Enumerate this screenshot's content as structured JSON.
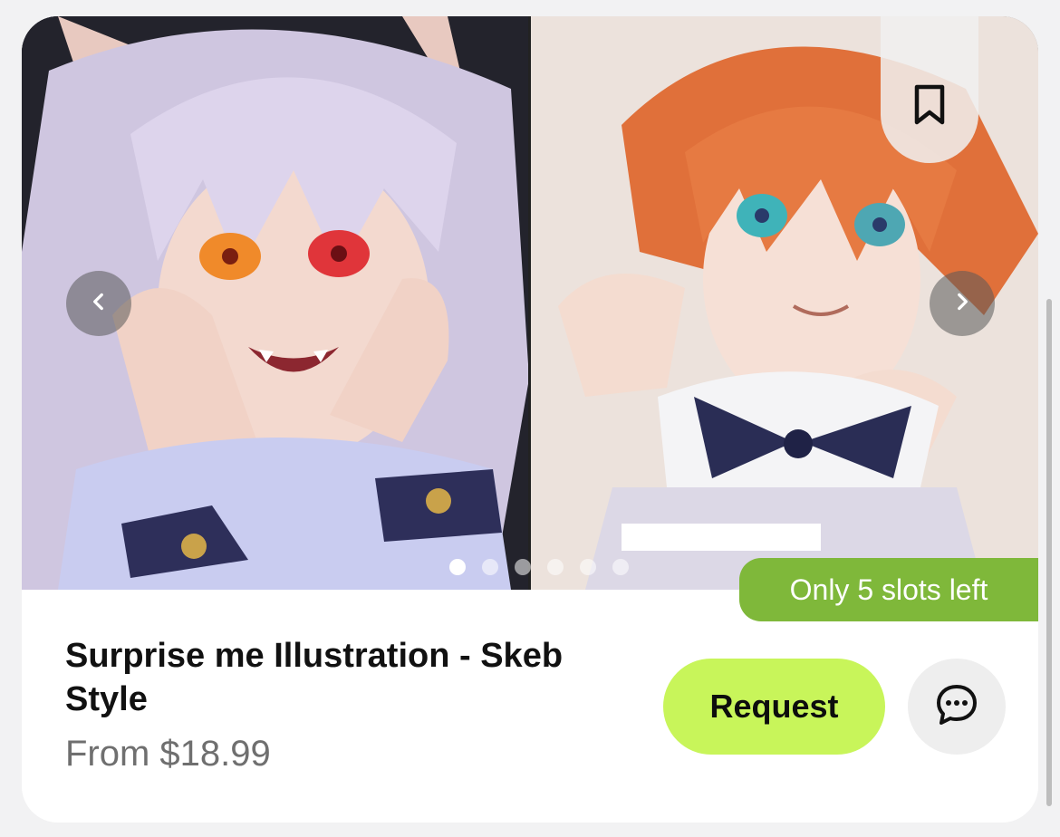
{
  "listing": {
    "title": "Surprise me Illustration - Skeb Style",
    "price": "From $18.99",
    "slots_badge": "Only 5 slots left",
    "request_label": "Request",
    "gallery": {
      "slide_count": 6,
      "active_index": 0,
      "images": [
        {
          "name": "white-haired-fox-girl-illustration"
        },
        {
          "name": "orange-haired-boy-illustration"
        }
      ]
    }
  },
  "icons": {
    "bookmark": "bookmark-icon",
    "prev": "chevron-left-icon",
    "next": "chevron-right-icon",
    "chat": "chat-bubble-icon"
  },
  "colors": {
    "accent": "#c8f55a",
    "badge": "#7fb83a",
    "price_text": "#6f6f6f"
  }
}
